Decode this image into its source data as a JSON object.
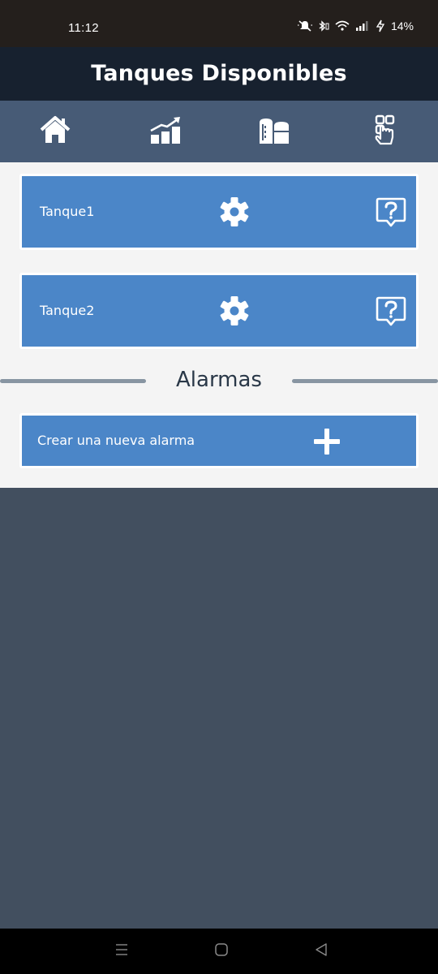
{
  "status_bar": {
    "time": "11:12",
    "battery": "14%",
    "icons": [
      "mute-icon",
      "bluetooth-icon",
      "wifi-icon",
      "signal-icon",
      "charging-icon"
    ]
  },
  "header": {
    "title": "Tanques Disponibles"
  },
  "nav": {
    "items": [
      {
        "name": "home",
        "icon": "home-icon"
      },
      {
        "name": "stats",
        "icon": "chart-icon"
      },
      {
        "name": "tanks",
        "icon": "tanks-icon"
      },
      {
        "name": "touch",
        "icon": "touch-icon"
      }
    ]
  },
  "tanks": [
    {
      "name": "Tanque1",
      "settings_icon": "gear-icon",
      "help_icon": "help-icon"
    },
    {
      "name": "Tanque2",
      "settings_icon": "gear-icon",
      "help_icon": "help-icon"
    }
  ],
  "alarms": {
    "section_title": "Alarmas",
    "create_label": "Crear una nueva alarma",
    "create_icon": "plus-icon"
  },
  "colors": {
    "status_bar": "#241f1c",
    "title_bar": "#17212f",
    "nav_bar": "#475b76",
    "card": "#4b86c8",
    "content_bg": "#f4f4f4",
    "page_bg": "#424f5f",
    "divider": "#8895a2",
    "section_title": "#2a3848"
  },
  "system_nav": {
    "icons": [
      "recents-icon",
      "home-circle-icon",
      "back-icon"
    ]
  }
}
